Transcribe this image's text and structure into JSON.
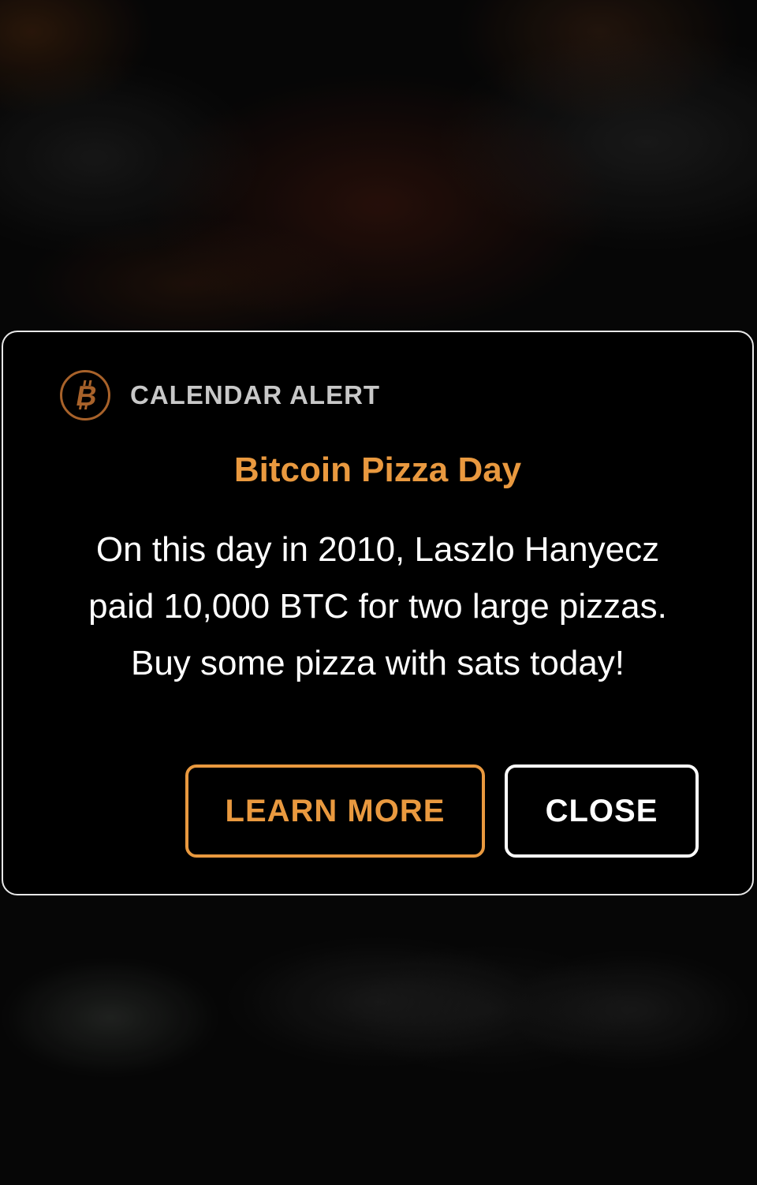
{
  "alert": {
    "category_label": "CALENDAR ALERT",
    "icon": "bitcoin-icon",
    "title": "Bitcoin Pizza Day",
    "body_lines": [
      "On this day in 2010, Laszlo Hanyecz",
      "paid 10,000 BTC for two large pizzas.",
      "Buy some pizza with sats today!"
    ],
    "buttons": {
      "learn_more_label": "LEARN MORE",
      "close_label": "CLOSE"
    }
  },
  "colors": {
    "accent": "#e9993f",
    "icon_accent": "#a8622a",
    "modal_background": "#000000",
    "modal_border": "#e8e8e8",
    "text": "#ffffff",
    "muted_text": "#c8c8c8"
  }
}
